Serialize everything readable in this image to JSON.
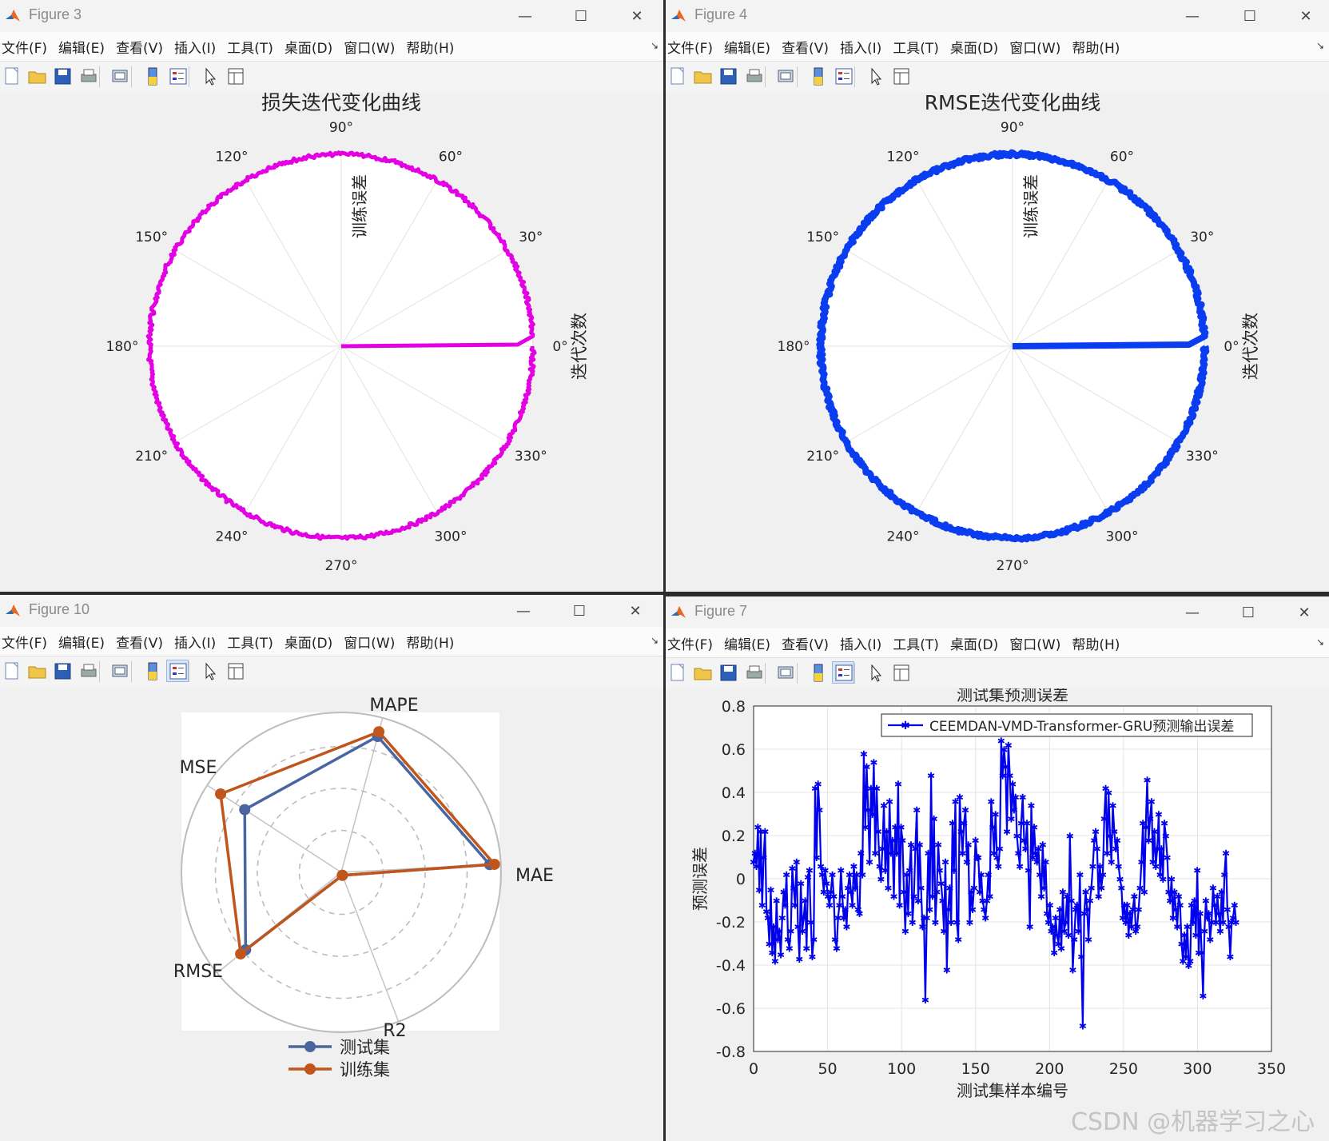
{
  "menu": [
    "文件(F)",
    "编辑(E)",
    "查看(V)",
    "插入(I)",
    "工具(T)",
    "桌面(D)",
    "窗口(W)",
    "帮助(H)"
  ],
  "window_buttons": {
    "minimize": "—",
    "maximize": "☐",
    "close": "✕"
  },
  "colors": {
    "magenta": "#e300e3",
    "blue": "#0a3cf0",
    "test_series": "#4a66a0",
    "train_series": "#c0561c",
    "error_line": "#0000ee"
  },
  "fig3": {
    "title": "Figure 3",
    "plot_title": "损失迭代变化曲线",
    "radial_label": "训练误差",
    "right_label": "迭代次数",
    "angle_labels": [
      "0°",
      "30°",
      "60°",
      "90°",
      "120°",
      "150°",
      "180°",
      "210°",
      "240°",
      "270°",
      "300°",
      "330°"
    ]
  },
  "fig4": {
    "title": "Figure 4",
    "plot_title": "RMSE迭代变化曲线",
    "radial_label": "训练误差",
    "right_label": "迭代次数",
    "angle_labels": [
      "0°",
      "30°",
      "60°",
      "90°",
      "120°",
      "150°",
      "180°",
      "210°",
      "240°",
      "270°",
      "300°",
      "330°"
    ]
  },
  "fig10": {
    "title": "Figure 10",
    "axes": [
      "MAE",
      "MAPE",
      "MSE",
      "RMSE",
      "R2"
    ],
    "legend": [
      "测试集",
      "训练集"
    ]
  },
  "fig7": {
    "title": "Figure 7",
    "plot_title": "测试集预测误差",
    "ylabel": "预测误差",
    "xlabel": "测试集样本编号",
    "legend": "CEEMDAN-VMD-Transformer-GRU预测输出误差",
    "xticks": [
      "0",
      "50",
      "100",
      "150",
      "200",
      "250",
      "300",
      "350"
    ],
    "yticks": [
      "0.8",
      "0.6",
      "0.4",
      "0.2",
      "0",
      "-0.2",
      "-0.4",
      "-0.6",
      "-0.8"
    ]
  },
  "watermark": "CSDN @机器学习之心",
  "chart_data": [
    {
      "type": "polar-line",
      "title": "损失迭代变化曲线",
      "theta_label": "迭代次数",
      "r_label": "训练误差",
      "series": [
        {
          "name": "",
          "description_points": [
            {
              "theta_deg": 0,
              "r": 0
            },
            {
              "theta_deg": 0,
              "r": 0.92
            },
            {
              "theta_deg": 3,
              "r": 0.99
            },
            {
              "theta_deg": 90,
              "r": 1.0
            },
            {
              "theta_deg": 180,
              "r": 1.0
            },
            {
              "theta_deg": 270,
              "r": 1.0
            },
            {
              "theta_deg": 360,
              "r": 1.0
            }
          ]
        }
      ]
    },
    {
      "type": "polar-line",
      "title": "RMSE迭代变化曲线",
      "theta_label": "迭代次数",
      "r_label": "训练误差",
      "series": [
        {
          "name": "",
          "description_points": [
            {
              "theta_deg": 0,
              "r": 0
            },
            {
              "theta_deg": 0,
              "r": 0.92
            },
            {
              "theta_deg": 3,
              "r": 0.99
            },
            {
              "theta_deg": 90,
              "r": 1.0
            },
            {
              "theta_deg": 180,
              "r": 1.0
            },
            {
              "theta_deg": 270,
              "r": 1.0
            },
            {
              "theta_deg": 360,
              "r": 1.0
            }
          ]
        }
      ]
    },
    {
      "type": "radar",
      "categories": [
        "MAE",
        "MAPE",
        "MSE",
        "RMSE",
        "R2"
      ],
      "rmax": 1.0,
      "series": [
        {
          "name": "测试集",
          "values": [
            0.93,
            0.88,
            0.72,
            0.77,
            0.02
          ]
        },
        {
          "name": "训练集",
          "values": [
            0.96,
            0.91,
            0.9,
            0.81,
            0.02
          ]
        }
      ]
    },
    {
      "type": "line",
      "title": "测试集预测误差",
      "xlabel": "测试集样本编号",
      "ylabel": "预测误差",
      "xlim": [
        0,
        350
      ],
      "ylim": [
        -0.8,
        0.8
      ],
      "grid": true,
      "legend_position": "top-right",
      "series": [
        {
          "name": "CEEMDAN-VMD-Transformer-GRU预测输出误差",
          "values": [
            0.08,
            0.12,
            0.06,
            0.24,
            -0.05,
            0.22,
            -0.12,
            0.1,
            0.22,
            -0.15,
            -0.18,
            -0.3,
            -0.05,
            -0.34,
            -0.22,
            -0.38,
            -0.1,
            -0.28,
            -0.24,
            -0.35,
            -0.18,
            -0.06,
            -0.12,
            0.02,
            -0.28,
            -0.32,
            -0.24,
            0.05,
            -0.04,
            -0.12,
            0.08,
            -0.22,
            -0.37,
            -0.02,
            -0.24,
            -0.18,
            -0.1,
            -0.32,
            0.01,
            0.04,
            -0.2,
            -0.36,
            -0.28,
            0.42,
            0.1,
            0.44,
            0.32,
            0.06,
            0.02,
            -0.06,
            0.04,
            -0.02,
            -0.08,
            -0.12,
            -0.06,
            0.02,
            -0.08,
            -0.28,
            -0.32,
            -0.18,
            -0.12,
            0.04,
            -0.08,
            -0.18,
            -0.14,
            -0.22,
            -0.04,
            0.02,
            -0.06,
            -0.12,
            0.06,
            -0.04,
            0.02,
            -0.14,
            -0.16,
            0.12,
            0.02,
            0.58,
            0.24,
            0.52,
            0.32,
            0.08,
            0.42,
            0.3,
            0.54,
            0.12,
            0.42,
            0.22,
            0.06,
            0.0,
            0.14,
            0.34,
            0.04,
            0.22,
            -0.04,
            0.36,
            0.12,
            0.18,
            -0.08,
            0.24,
            0.12,
            0.44,
            -0.12,
            0.24,
            0.18,
            -0.06,
            -0.24,
            0.02,
            -0.16,
            0.04,
            0.16,
            -0.2,
            -0.08,
            0.14,
            0.32,
            -0.1,
            0.16,
            -0.04,
            -0.22,
            -0.18,
            -0.56,
            -0.18,
            0.12,
            -0.14,
            0.48,
            -0.08,
            0.28,
            -0.2,
            -0.06,
            0.16,
            0.04,
            -0.02,
            -0.1,
            -0.24,
            0.08,
            -0.42,
            -0.14,
            -0.04,
            -0.2,
            0.26,
            0.04,
            0.36,
            -0.2,
            -0.28,
            0.38,
            0.22,
            0.12,
            0.26,
            0.32,
            0.08,
            0.16,
            -0.2,
            -0.06,
            -0.14,
            -0.04,
            0.18,
            0.1,
            0.1,
            -0.06,
            0.02,
            -0.1,
            -0.14,
            -0.18,
            -0.1,
            0.02,
            -0.08,
            0.36,
            0.24,
            0.12,
            0.3,
            0.1,
            0.06,
            0.14,
            0.64,
            0.48,
            0.6,
            0.52,
            0.22,
            0.62,
            0.48,
            0.28,
            0.44,
            0.32,
            0.38,
            0.2,
            0.12,
            0.06,
            0.26,
            0.38,
            0.18,
            0.14,
            0.26,
            0.04,
            -0.22,
            0.34,
            0.1,
            0.24,
            0.12,
            0.08,
            0.14,
            0.02,
            -0.08,
            0.16,
            -0.04,
            0.08,
            -0.16,
            -0.2,
            -0.12,
            -0.24,
            -0.22,
            -0.34,
            -0.18,
            -0.26,
            -0.3,
            -0.14,
            -0.32,
            -0.06,
            -0.24,
            -0.2,
            -0.08,
            -0.26,
            0.2,
            -0.1,
            -0.42,
            -0.28,
            -0.14,
            -0.12,
            -0.24,
            0.02,
            -0.36,
            -0.68,
            -0.16,
            -0.06,
            -0.14,
            -0.28,
            -0.1,
            -0.04,
            0.06,
            0.18,
            0.22,
            0.14,
            -0.08,
            0.06,
            -0.04,
            0.02,
            0.28,
            0.42,
            0.12,
            0.4,
            0.2,
            0.08,
            0.34,
            0.22,
            0.14,
            0.18,
            0.06,
            0.0,
            -0.04,
            -0.18,
            -0.12,
            -0.2,
            -0.12,
            -0.26,
            -0.16,
            -0.22,
            -0.14,
            -0.08,
            -0.24,
            -0.22,
            -0.14,
            -0.04,
            0.08,
            0.26,
            -0.06,
            0.24,
            0.46,
            0.18,
            0.28,
            0.36,
            0.08,
            0.22,
            0.06,
            0.14,
            0.3,
            0.02,
            0.14,
            0.0,
            0.26,
            0.2,
            0.1,
            -0.06,
            -0.1,
            0.0,
            -0.18,
            -0.06,
            -0.14,
            -0.22,
            -0.08,
            -0.12,
            -0.3,
            -0.38,
            -0.26,
            -0.36,
            -0.22,
            -0.4,
            -0.38,
            -0.12,
            -0.2,
            -0.1,
            -0.26,
            0.04,
            -0.34,
            -0.16,
            -0.34,
            -0.54,
            -0.24,
            -0.1,
            -0.18,
            -0.16,
            -0.28,
            -0.2,
            -0.04,
            -0.12,
            -0.2,
            -0.08,
            -0.16,
            -0.24,
            -0.06,
            -0.2,
            0.02,
            0.12,
            -0.14,
            -0.22,
            -0.36,
            -0.2,
            -0.18,
            -0.12,
            -0.2
          ]
        }
      ]
    }
  ]
}
